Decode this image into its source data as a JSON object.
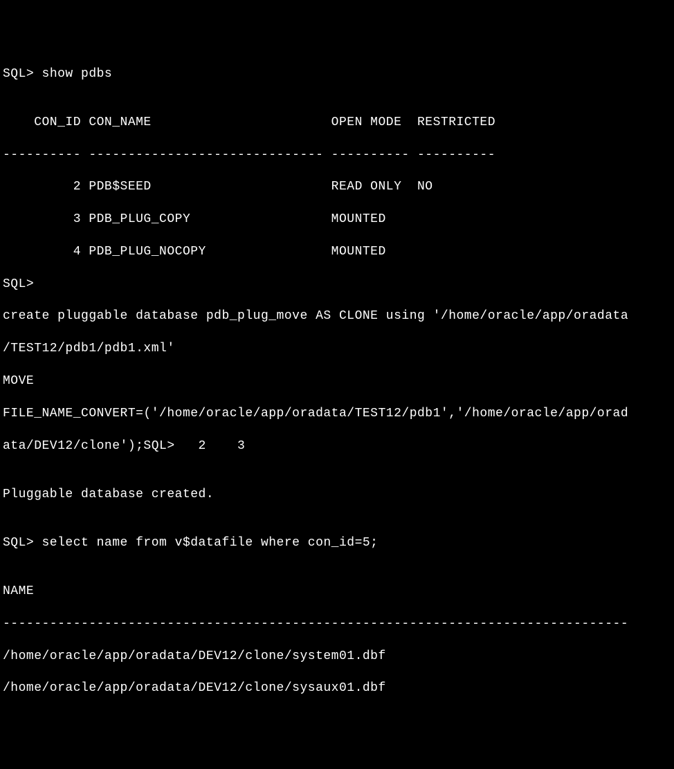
{
  "terminal": {
    "prompt": "SQL>",
    "cmd1": " show pdbs",
    "blank": "",
    "header": "    CON_ID CON_NAME                       OPEN MODE  RESTRICTED",
    "divider1": "---------- ------------------------------ ---------- ----------",
    "row1": "         2 PDB$SEED                       READ ONLY  NO",
    "row2": "         3 PDB_PLUG_COPY                  MOUNTED",
    "row3": "         4 PDB_PLUG_NOCOPY                MOUNTED",
    "prompt2": "SQL>",
    "stmt1": "create pluggable database pdb_plug_move AS CLONE using '/home/oracle/app/oradata",
    "stmt2": "/TEST12/pdb1/pdb1.xml'",
    "stmt3": "MOVE",
    "stmt4": "FILE_NAME_CONVERT=('/home/oracle/app/oradata/TEST12/pdb1','/home/oracle/app/orad",
    "stmt5": "ata/DEV12/clone');SQL>   2    3",
    "result1": "Pluggable database created.",
    "cmd2": "SQL> select name from v$datafile where con_id=5;",
    "nameheader": "NAME",
    "divider2": "--------------------------------------------------------------------------------",
    "path1": "/home/oracle/app/oradata/DEV12/clone/system01.dbf",
    "path2": "/home/oracle/app/oradata/DEV12/clone/sysaux01.dbf"
  }
}
